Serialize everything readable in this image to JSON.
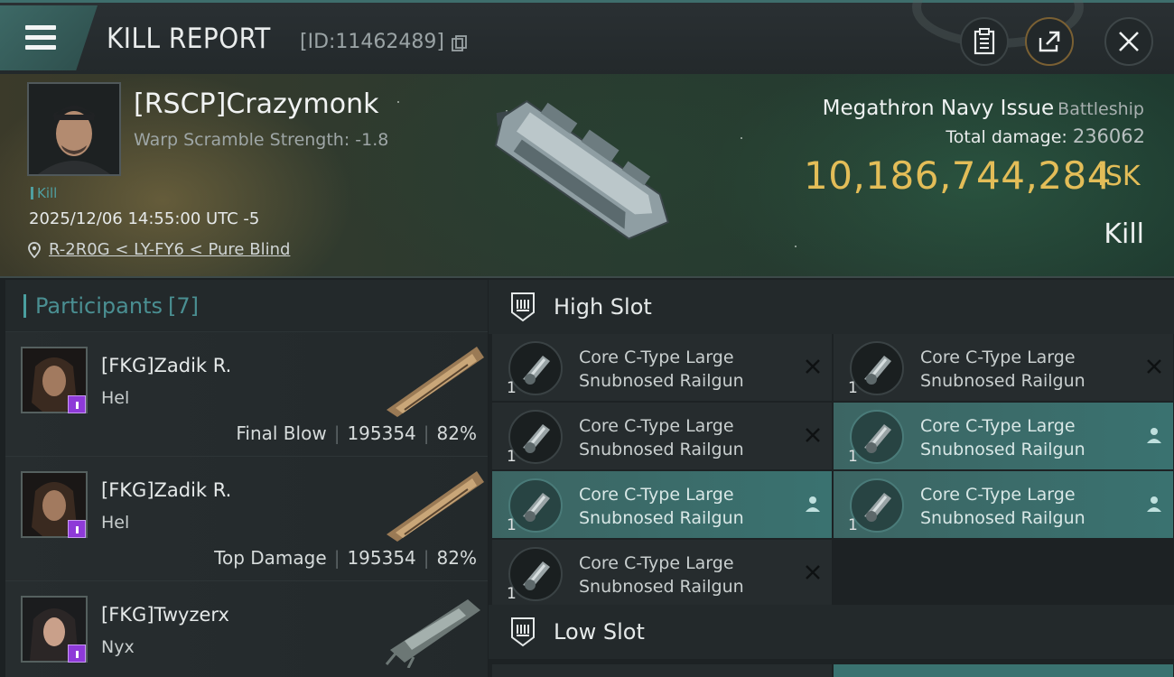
{
  "header": {
    "title": "KILL REPORT",
    "report_id": "[ID:11462489]"
  },
  "victim": {
    "name": "[RSCP]Crazymonk",
    "warp_scramble": "Warp Scramble Strength: -1.8",
    "tag": "Kill",
    "time": "2025/12/06 14:55:00 UTC -5",
    "location": "R-2R0G < LY-FY6 < Pure Blind",
    "ship_name": "Megathron Navy Issue",
    "ship_class": "Battleship",
    "total_damage_label": "Total damage:",
    "total_damage_value": "236062",
    "isk_value": "10,186,744,284",
    "isk_unit": "ISK",
    "result": "Kill"
  },
  "participants": {
    "label": "Participants",
    "count": "[7]",
    "rows": [
      {
        "name": "[FKG]Zadik R.",
        "ship": "Hel",
        "role": "Final Blow",
        "damage": "195354",
        "percent": "82%"
      },
      {
        "name": "[FKG]Zadik R.",
        "ship": "Hel",
        "role": "Top Damage",
        "damage": "195354",
        "percent": "82%"
      },
      {
        "name": "[FKG]Twyzerx",
        "ship": "Nyx",
        "role": "",
        "damage": "",
        "percent": ""
      }
    ]
  },
  "fitting": {
    "high_slot_label": "High Slot",
    "low_slot_label": "Low Slot",
    "high_slot_modules": [
      {
        "name": "Core C-Type Large Snubnosed Railgun",
        "qty": "1",
        "status": "destroyed"
      },
      {
        "name": "Core C-Type Large Snubnosed Railgun",
        "qty": "1",
        "status": "destroyed"
      },
      {
        "name": "Core C-Type Large Snubnosed Railgun",
        "qty": "1",
        "status": "destroyed"
      },
      {
        "name": "Core C-Type Large Snubnosed Railgun",
        "qty": "1",
        "status": "dropped"
      },
      {
        "name": "Core C-Type Large Snubnosed Railgun",
        "qty": "1",
        "status": "dropped"
      },
      {
        "name": "Core C-Type Large Snubnosed Railgun",
        "qty": "1",
        "status": "dropped"
      },
      {
        "name": "Core C-Type Large Snubnosed Railgun",
        "qty": "1",
        "status": "destroyed"
      }
    ]
  },
  "colors": {
    "accent": "#3e6e6c",
    "isk": "#e3bd58",
    "dropped_bg": "#3a7270",
    "participant_badge": "#8e3ad8"
  }
}
